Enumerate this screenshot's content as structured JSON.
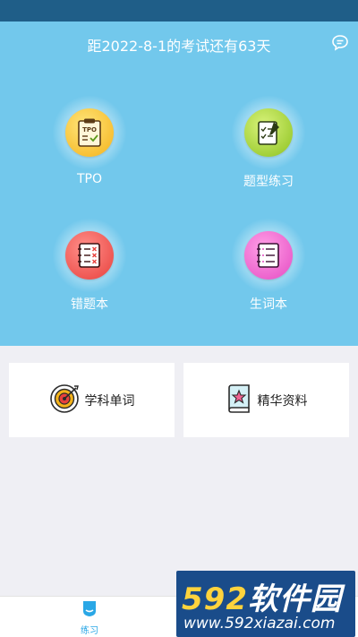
{
  "header": {
    "countdown": "距2022-8-1的考试还有63天",
    "chat_icon": "chat-bubble-icon"
  },
  "tiles": [
    {
      "label": "TPO",
      "icon": "tpo-clipboard-icon",
      "color": "#f4b21a"
    },
    {
      "label": "题型练习",
      "icon": "checklist-pencil-icon",
      "color": "#8cc21f"
    },
    {
      "label": "错题本",
      "icon": "wrong-answers-list-icon",
      "color": "#e8403c"
    },
    {
      "label": "生词本",
      "icon": "vocabulary-notebook-icon",
      "color": "#e54bc3"
    }
  ],
  "cards": [
    {
      "label": "学科单词",
      "icon": "target-icon"
    },
    {
      "label": "精华资料",
      "icon": "star-book-icon"
    }
  ],
  "tabbar": {
    "tabs": [
      {
        "label": "练习",
        "icon": "practice-icon",
        "active": true
      },
      {
        "label": "",
        "icon": "",
        "active": false
      }
    ]
  },
  "watermark": {
    "brand_digits": "592",
    "brand_text": "软件园",
    "url": "www.592xiazai.com"
  },
  "colors": {
    "status_bar": "#1f5e88",
    "hero": "#72c8ec",
    "accent": "#2aa7e6",
    "page_bg": "#efeff4"
  }
}
